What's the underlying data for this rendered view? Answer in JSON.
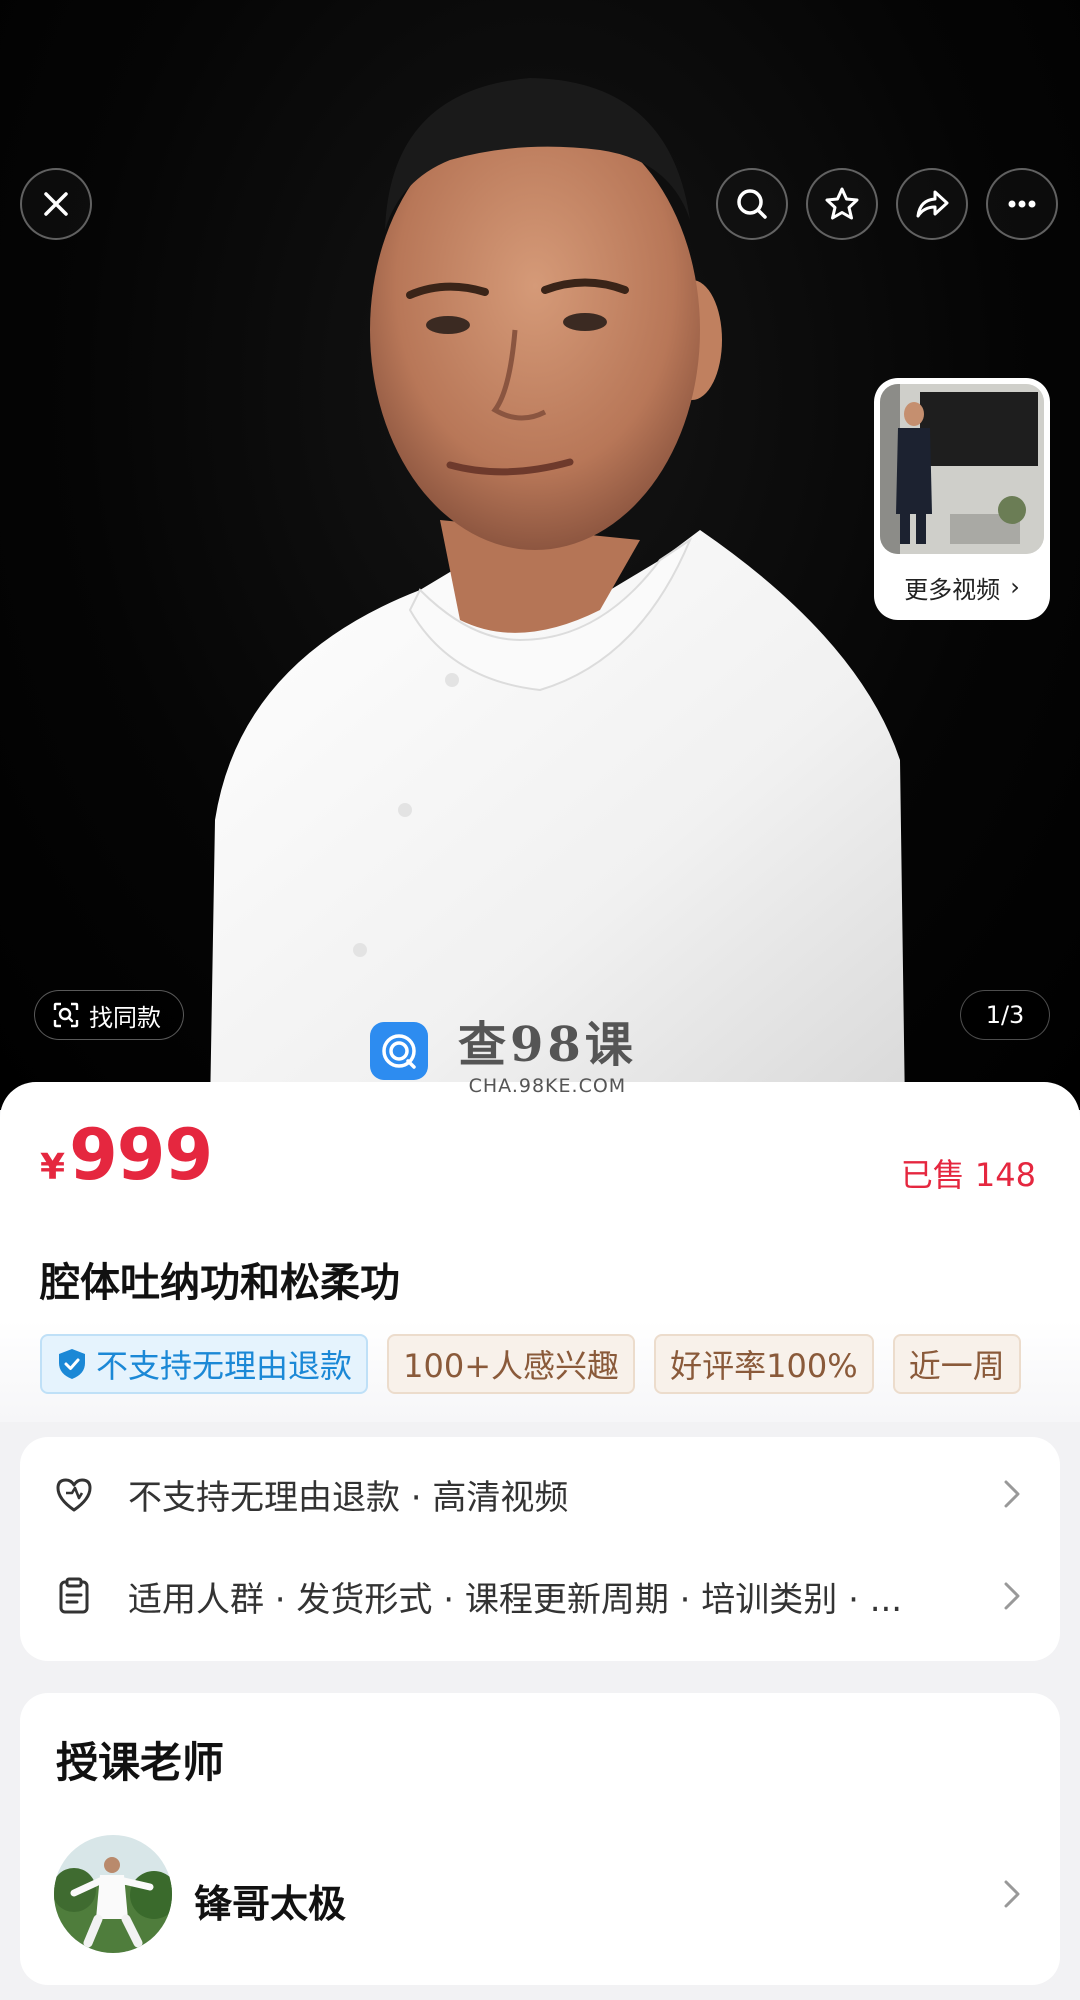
{
  "hero": {
    "more_videos_label": "更多视频",
    "find_same_label": "找同款",
    "page_counter": "1/3",
    "top_buttons": [
      "close-icon",
      "search-icon",
      "star-icon",
      "share-icon",
      "more-icon"
    ]
  },
  "watermark": {
    "main": "查98课",
    "sub": "CHA.98KE.COM"
  },
  "product": {
    "currency": "¥",
    "price": "999",
    "sold": "已售 148",
    "title": "腔体吐纳功和松柔功",
    "tags": [
      "不支持无理由退款",
      "100+人感兴趣",
      "好评率100%",
      "近一周"
    ]
  },
  "service": {
    "row1": "不支持无理由退款 · 高清视频",
    "row2": "适用人群 · 发货形式 · 课程更新周期 · 培训类别 · ..."
  },
  "teacher": {
    "section_title": "授课老师",
    "name": "锋哥太极"
  },
  "colors": {
    "price_red": "#e5273f",
    "tag_blue": "#1b88d6",
    "tag_tan": "#8a5a3a",
    "watermark_blue": "#2d8cf0"
  }
}
